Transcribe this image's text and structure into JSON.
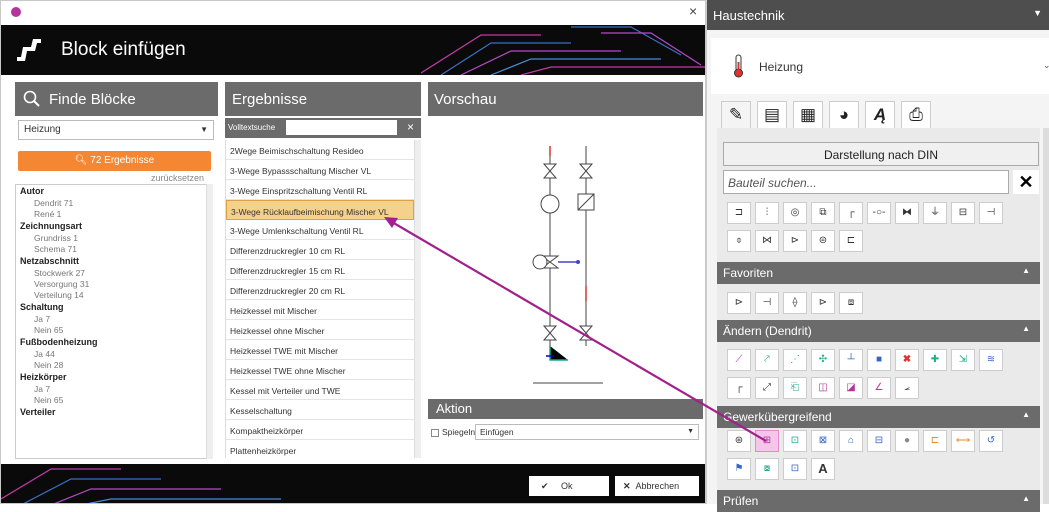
{
  "dialog": {
    "title": "Block einfügen",
    "close": "×",
    "panel_find": "Finde Blöcke",
    "panel_results": "Ergebnisse",
    "panel_preview": "Vorschau",
    "dropdown_value": "Heizung",
    "results_button": "72 Ergebnisse",
    "reset": "zurücksetzen",
    "fulltext_label": "Volltextsuche",
    "fulltext_clear": "×",
    "action_header": "Aktion",
    "mirror_label": "Spiegeln",
    "insert_value": "Einfügen",
    "ok": "Ok",
    "cancel": "Abbrechen"
  },
  "facets": [
    {
      "type": "h",
      "text": "Autor"
    },
    {
      "type": "i",
      "text": "Dendrit 71"
    },
    {
      "type": "i",
      "text": "René 1"
    },
    {
      "type": "h",
      "text": "Zeichnungsart"
    },
    {
      "type": "i",
      "text": "Grundriss 1"
    },
    {
      "type": "i",
      "text": "Schema 71"
    },
    {
      "type": "h",
      "text": "Netzabschnitt"
    },
    {
      "type": "i",
      "text": "Stockwerk 27"
    },
    {
      "type": "i",
      "text": "Versorgung 31"
    },
    {
      "type": "i",
      "text": "Verteilung 14"
    },
    {
      "type": "h",
      "text": "Schaltung"
    },
    {
      "type": "i",
      "text": "Ja 7"
    },
    {
      "type": "i",
      "text": "Nein 65"
    },
    {
      "type": "h",
      "text": "Fußbodenheizung"
    },
    {
      "type": "i",
      "text": "Ja 44"
    },
    {
      "type": "i",
      "text": "Nein 28"
    },
    {
      "type": "h",
      "text": "Heizkörper"
    },
    {
      "type": "i",
      "text": "Ja 7"
    },
    {
      "type": "i",
      "text": "Nein 65"
    },
    {
      "type": "h",
      "text": "Verteiler"
    }
  ],
  "results": [
    "2Wege Beimischschaltung Resideo",
    "3-Wege Bypassschaltung Mischer VL",
    "3-Wege Einspritzschaltung Ventil RL",
    "3-Wege Rücklaufbeimischung Mischer VL",
    "3-Wege Umlenkschaltung Ventil RL",
    "Differenzdruckregler 10 cm RL",
    "Differenzdruckregler 15 cm RL",
    "Differenzdruckregler 20 cm RL",
    "Heizkessel mit Mischer",
    "Heizkessel ohne Mischer",
    "Heizkessel TWE mit Mischer",
    "Heizkessel TWE ohne Mischer",
    "Kessel mit Verteiler und TWE",
    "Kesselschaltung",
    "Kompaktheizkörper",
    "Plattenheizkörper"
  ],
  "selected_result_index": 3,
  "panel": {
    "header": "Haustechnik",
    "category": "Heizung",
    "din_button": "Darstellung nach DIN",
    "search_placeholder": "Bauteil suchen...",
    "search_clear": "✕",
    "sections": [
      "Favoriten",
      "Ändern (Dendrit)",
      "Gewerkübergreifend",
      "Prüfen"
    ],
    "tab_icons": [
      "pencil-icon",
      "list-icon",
      "calculator-icon",
      "pie-icon",
      "text-style-icon",
      "printer-icon"
    ],
    "text_tool_glyph": "A"
  }
}
